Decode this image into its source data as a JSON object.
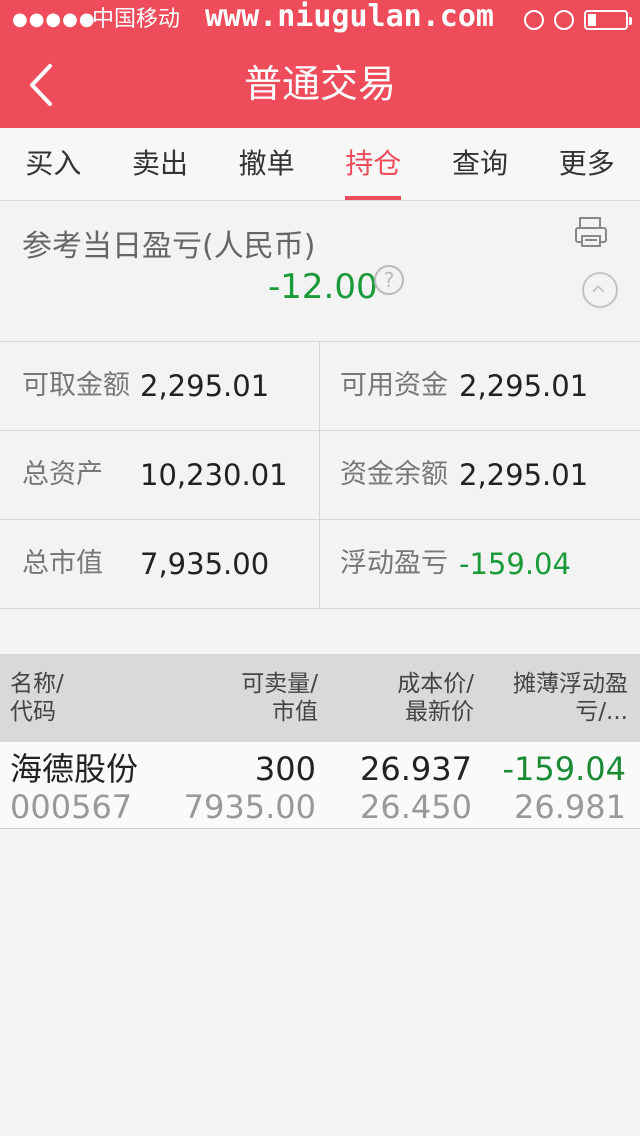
{
  "status_bar": {
    "signal": "●●●●●",
    "carrier": "中国移动",
    "watermark": "www.niugulan.com"
  },
  "header": {
    "title": "普通交易"
  },
  "tabs": [
    {
      "label": "买入"
    },
    {
      "label": "卖出"
    },
    {
      "label": "撤单"
    },
    {
      "label": "持仓"
    },
    {
      "label": "查询"
    },
    {
      "label": "更多"
    }
  ],
  "active_tab": "持仓",
  "summary": {
    "label": "参考当日盈亏(人民币)",
    "value": "-12.00",
    "help_glyph": "?"
  },
  "account": {
    "withdrawable_label": "可取金额",
    "withdrawable_value": "2,295.01",
    "available_label": "可用资金",
    "available_value": "2,295.01",
    "total_assets_label": "总资产",
    "total_assets_value": "10,230.01",
    "balance_label": "资金余额",
    "balance_value": "2,295.01",
    "market_value_label": "总市值",
    "market_value_value": "7,935.00",
    "floating_pl_label": "浮动盈亏",
    "floating_pl_value": "-159.04"
  },
  "holdings": {
    "columns": [
      {
        "line1": "名称/",
        "line2": "代码"
      },
      {
        "line1": "可卖量/",
        "line2": "市值"
      },
      {
        "line1": "成本价/",
        "line2": "最新价"
      },
      {
        "line1": "摊薄浮动盈",
        "line2": "亏/..."
      }
    ],
    "rows": [
      {
        "name": "海德股份",
        "code": "000567",
        "sellable": "300",
        "market_value": "7935.00",
        "cost_price": "26.937",
        "latest_price": "26.450",
        "floating_pl": "-159.04",
        "diluted": "26.981"
      }
    ]
  },
  "colors": {
    "brand": "#ee4c5a",
    "loss_green": "#1a9b3a"
  }
}
